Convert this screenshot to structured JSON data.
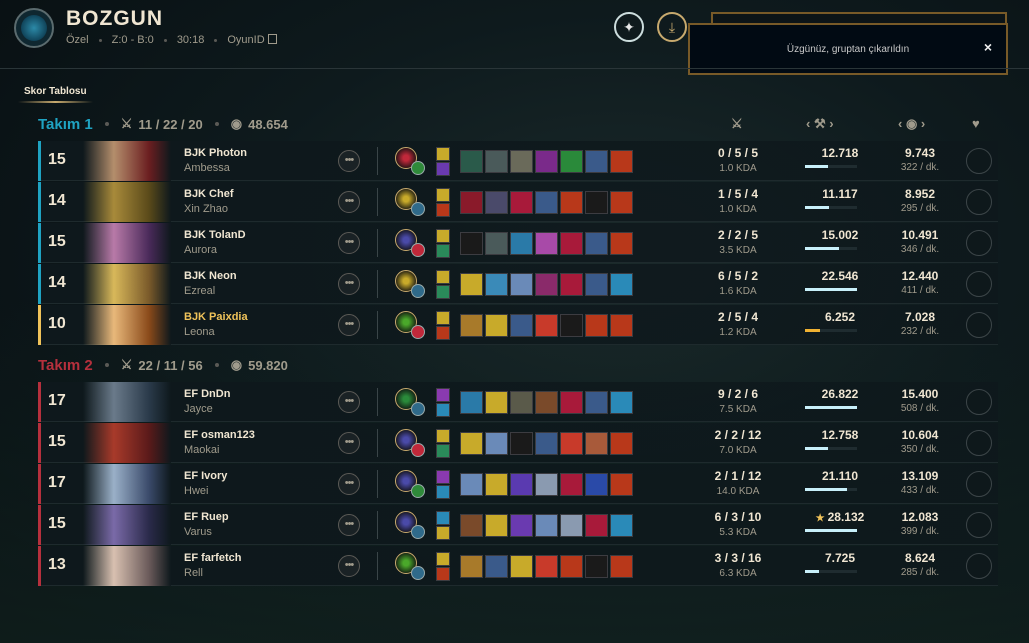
{
  "header": {
    "title": "BOZGUN",
    "queue": "Özel",
    "score": "Z:0 - B:0",
    "duration": "30:18",
    "game_id_label": "OyunID"
  },
  "toast": {
    "message": "Üzgünüz, gruptan çıkarıldın",
    "close": "×"
  },
  "section_tab": "Skor Tablosu",
  "colors": {
    "team1": "#1fa3c2",
    "team2": "#b6303d",
    "gold": "#c8aa6e",
    "highlight": "#f0c35a"
  },
  "teams": [
    {
      "name": "Takım 1",
      "kda": "11 / 22 / 20",
      "gold": "48.654",
      "color": "#1fa3c2",
      "players": [
        {
          "level": "15",
          "name": "BJK Photon",
          "champion": "Ambessa",
          "kda": "0 / 5 / 5",
          "kda_ratio": "1.0 KDA",
          "damage": "12.718",
          "damage_pct": 0.45,
          "gold": "9.743",
          "gpm": "322 / dk.",
          "star": false,
          "me": false,
          "portrait": [
            "#6b1e20",
            "#b48e6c"
          ],
          "rune": "#c0283a",
          "sec": "#2f8a3a",
          "spells": [
            "#c8aa2a",
            "#6a3ab0"
          ],
          "items": [
            "#2a5a4a",
            "#4a5a5a",
            "#6a6a5a",
            "#7a2a8a",
            "#2a8a3a",
            "#3a5a8a",
            "#b8381a"
          ]
        },
        {
          "level": "14",
          "name": "BJK Chef",
          "champion": "Xin Zhao",
          "kda": "1 / 5 / 4",
          "kda_ratio": "1.0 KDA",
          "damage": "11.117",
          "damage_pct": 0.47,
          "gold": "8.952",
          "gpm": "295 / dk.",
          "star": false,
          "me": false,
          "portrait": [
            "#5a4a1a",
            "#a88a3a"
          ],
          "rune": "#c8aa2a",
          "sec": "#2f6a8a",
          "spells": [
            "#c8aa2a",
            "#b8381a"
          ],
          "items": [
            "#8a1a2a",
            "#4a4a6a",
            "#a81a3a",
            "#3a5a8a",
            "#b8381a",
            "#1a1a1a",
            "#b8381a"
          ]
        },
        {
          "level": "15",
          "name": "BJK TolanD",
          "champion": "Aurora",
          "kda": "2 / 2 / 5",
          "kda_ratio": "3.5 KDA",
          "damage": "15.002",
          "damage_pct": 0.65,
          "gold": "10.491",
          "gpm": "346 / dk.",
          "star": false,
          "me": false,
          "portrait": [
            "#4a2a5a",
            "#b87aa8"
          ],
          "rune": "#4a4aa8",
          "sec": "#c0283a",
          "spells": [
            "#c8aa2a",
            "#2a8a5a"
          ],
          "items": [
            "#1a1a1a",
            "#4a5a5a",
            "#2a7aa8",
            "#a84aa8",
            "#a81a3a",
            "#3a5a8a",
            "#b8381a"
          ]
        },
        {
          "level": "14",
          "name": "BJK Neon",
          "champion": "Ezreal",
          "kda": "6 / 5 / 2",
          "kda_ratio": "1.6 KDA",
          "damage": "22.546",
          "damage_pct": 1.0,
          "gold": "12.440",
          "gpm": "411 / dk.",
          "star": false,
          "me": false,
          "portrait": [
            "#7a5a2a",
            "#d8b85a"
          ],
          "rune": "#c8aa2a",
          "sec": "#2f6a8a",
          "spells": [
            "#c8aa2a",
            "#2a8a5a"
          ],
          "items": [
            "#c8aa2a",
            "#3a8ab8",
            "#6a8ab8",
            "#8a2a6a",
            "#a81a3a",
            "#3a5a8a",
            "#2a8ab8"
          ]
        },
        {
          "level": "10",
          "name": "BJK Paixdia",
          "champion": "Leona",
          "kda": "2 / 5 / 4",
          "kda_ratio": "1.2 KDA",
          "damage": "6.252",
          "damage_pct": 0.28,
          "gold": "7.028",
          "gpm": "232 / dk.",
          "star": false,
          "me": true,
          "portrait": [
            "#8a4a1a",
            "#e8b87a"
          ],
          "rune": "#4aa82a",
          "sec": "#c0283a",
          "spells": [
            "#c8aa2a",
            "#b8381a"
          ],
          "items": [
            "#a87a2a",
            "#c8aa2a",
            "#3a5a8a",
            "#c83a2a",
            "#1a1a1a",
            "#b8381a",
            "#b8381a"
          ]
        }
      ]
    },
    {
      "name": "Takım 2",
      "kda": "22 / 11 / 56",
      "gold": "59.820",
      "color": "#b6303d",
      "players": [
        {
          "level": "17",
          "name": "EF DnDn",
          "champion": "Jayce",
          "kda": "9 / 2 / 6",
          "kda_ratio": "7.5 KDA",
          "damage": "26.822",
          "damage_pct": 1.0,
          "gold": "15.400",
          "gpm": "508 / dk.",
          "star": false,
          "me": false,
          "portrait": [
            "#2a3a4a",
            "#6a7a8a"
          ],
          "rune": "#2a8a3a",
          "sec": "#2f6a8a",
          "spells": [
            "#8a3ab0",
            "#2a8ab8"
          ],
          "items": [
            "#2a7aa8",
            "#c8aa2a",
            "#5a5a4a",
            "#7a4a2a",
            "#a81a3a",
            "#3a5a8a",
            "#2a8ab8"
          ]
        },
        {
          "level": "15",
          "name": "EF osman123",
          "champion": "Maokai",
          "kda": "2 / 2 / 12",
          "kda_ratio": "7.0 KDA",
          "damage": "12.758",
          "damage_pct": 0.45,
          "gold": "10.604",
          "gpm": "350 / dk.",
          "star": false,
          "me": false,
          "portrait": [
            "#5a1a1a",
            "#a83a2a"
          ],
          "rune": "#4a4aa8",
          "sec": "#c0283a",
          "spells": [
            "#c8aa2a",
            "#2a8a5a"
          ],
          "items": [
            "#c8aa2a",
            "#6a8ab8",
            "#1a1a1a",
            "#3a5a8a",
            "#c83a2a",
            "#a85a3a",
            "#b8381a"
          ]
        },
        {
          "level": "17",
          "name": "EF Ivory",
          "champion": "Hwei",
          "kda": "2 / 1 / 12",
          "kda_ratio": "14.0 KDA",
          "damage": "21.110",
          "damage_pct": 0.8,
          "gold": "13.109",
          "gpm": "433 / dk.",
          "star": false,
          "me": false,
          "portrait": [
            "#3a4a6a",
            "#9ab0c8"
          ],
          "rune": "#4a4aa8",
          "sec": "#2f8a3a",
          "spells": [
            "#8a3ab0",
            "#2a8ab8"
          ],
          "items": [
            "#6a8ab8",
            "#c8aa2a",
            "#5a3ab0",
            "#8a9ab0",
            "#a81a3a",
            "#2a4aa8",
            "#b8381a"
          ]
        },
        {
          "level": "15",
          "name": "EF Ruep",
          "champion": "Varus",
          "kda": "6 / 3 / 10",
          "kda_ratio": "5.3 KDA",
          "damage": "28.132",
          "damage_pct": 1.0,
          "gold": "12.083",
          "gpm": "399 / dk.",
          "star": true,
          "me": false,
          "portrait": [
            "#2a2a4a",
            "#7a6aa8"
          ],
          "rune": "#4a4aa8",
          "sec": "#2f6a8a",
          "spells": [
            "#2a8ab8",
            "#c8aa2a"
          ],
          "items": [
            "#7a4a2a",
            "#c8aa2a",
            "#6a3ab0",
            "#6a8ab8",
            "#8a9ab0",
            "#a81a3a",
            "#2a8ab8"
          ]
        },
        {
          "level": "13",
          "name": "EF farfetch",
          "champion": "Rell",
          "kda": "3 / 3 / 16",
          "kda_ratio": "6.3 KDA",
          "damage": "7.725",
          "damage_pct": 0.27,
          "gold": "8.624",
          "gpm": "285 / dk.",
          "star": false,
          "me": false,
          "portrait": [
            "#6a5a5a",
            "#d8c0b0"
          ],
          "rune": "#4aa82a",
          "sec": "#2f6a8a",
          "spells": [
            "#c8aa2a",
            "#b8381a"
          ],
          "items": [
            "#a87a2a",
            "#3a5a8a",
            "#c8aa2a",
            "#c83a2a",
            "#b8381a",
            "#1a1a1a",
            "#b8381a"
          ]
        }
      ]
    }
  ]
}
